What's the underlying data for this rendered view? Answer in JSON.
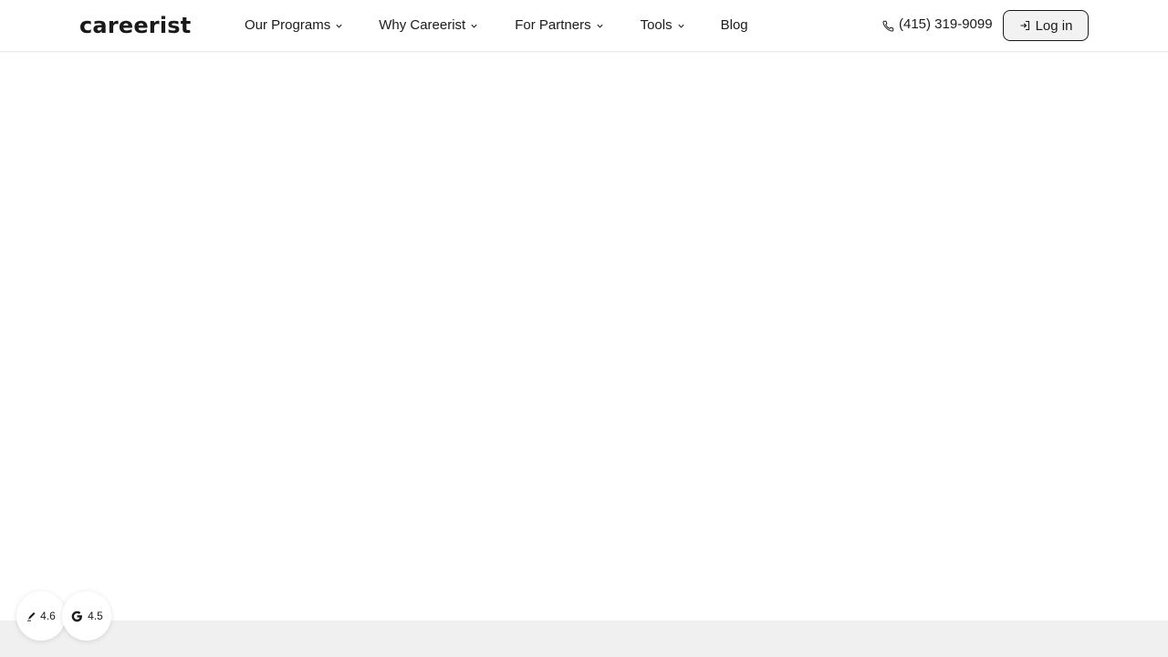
{
  "header": {
    "logo": "careerist",
    "nav": [
      {
        "label": "Our Programs",
        "has_dropdown": true
      },
      {
        "label": "Why Careerist",
        "has_dropdown": true
      },
      {
        "label": "For Partners",
        "has_dropdown": true
      },
      {
        "label": "Tools",
        "has_dropdown": true
      },
      {
        "label": "Blog",
        "has_dropdown": false
      }
    ],
    "phone": "(415) 319-9099",
    "login_label": "Log in"
  },
  "ratings": [
    {
      "icon": "pen-icon",
      "value": "4.6"
    },
    {
      "icon": "google-icon",
      "value": "4.5"
    }
  ],
  "colors": {
    "text": "#1a1a1a",
    "footer_band": "#f0f0f0",
    "login_bg": "#f2f2f2"
  }
}
